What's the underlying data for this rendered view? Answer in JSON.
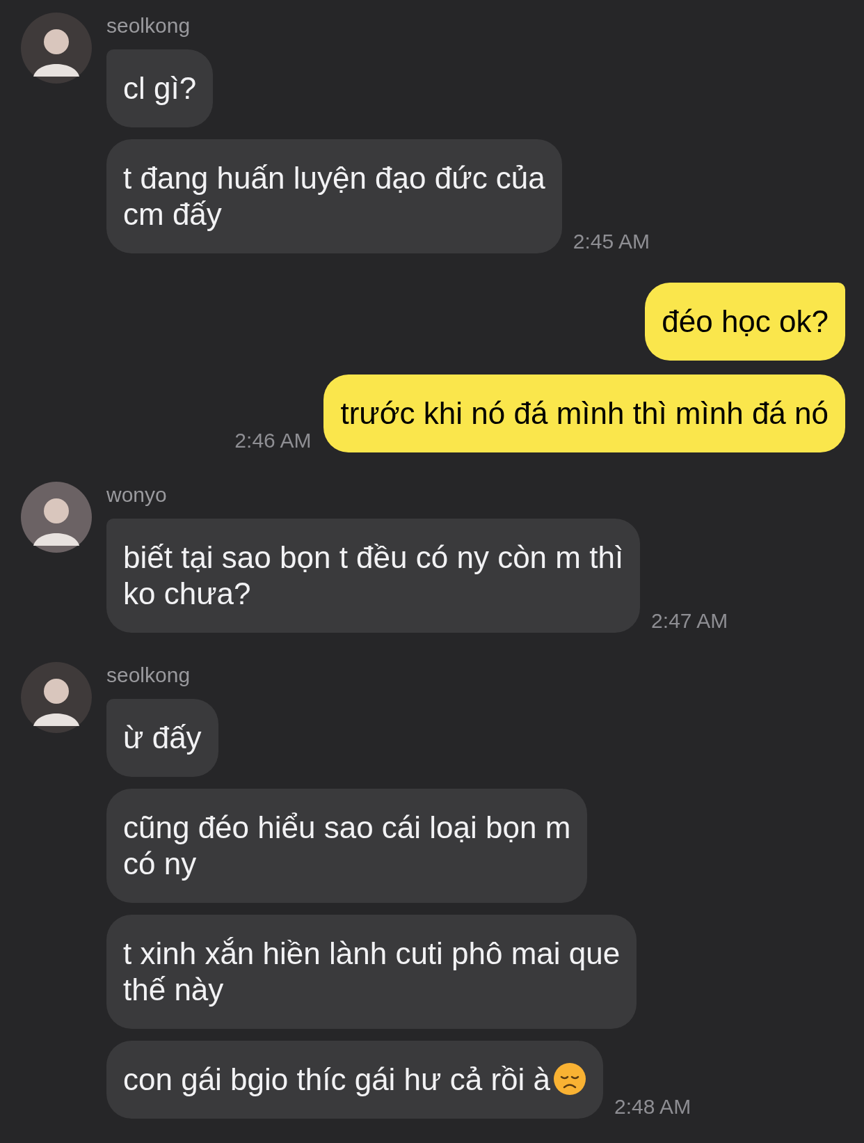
{
  "groups": [
    {
      "kind": "incoming",
      "sender": "seolkong",
      "messages": [
        {
          "text": "cl gì?"
        },
        {
          "text": "t đang huấn luyện đạo đức của\ncm đấy",
          "time": "2:45 AM"
        }
      ]
    },
    {
      "kind": "outgoing",
      "messages": [
        {
          "text": "đéo học ok?"
        },
        {
          "text": "trước khi nó đá mình thì mình đá nó",
          "time": "2:46 AM"
        }
      ]
    },
    {
      "kind": "incoming",
      "sender": "wonyo",
      "messages": [
        {
          "text": "biết tại sao bọn t đều có ny còn m thì\nko chưa?",
          "time": "2:47 AM"
        }
      ]
    },
    {
      "kind": "incoming",
      "sender": "seolkong",
      "messages": [
        {
          "text": "ừ đấy"
        },
        {
          "text": "cũng đéo hiểu sao cái loại bọn m\ncó ny"
        },
        {
          "text": "t xinh xắn hiền lành cuti phô mai que\nthế này"
        },
        {
          "text": "con gái bgio thíc gái hư cả rồi à",
          "trailing_icon": true,
          "time": "2:48 AM"
        }
      ]
    }
  ]
}
